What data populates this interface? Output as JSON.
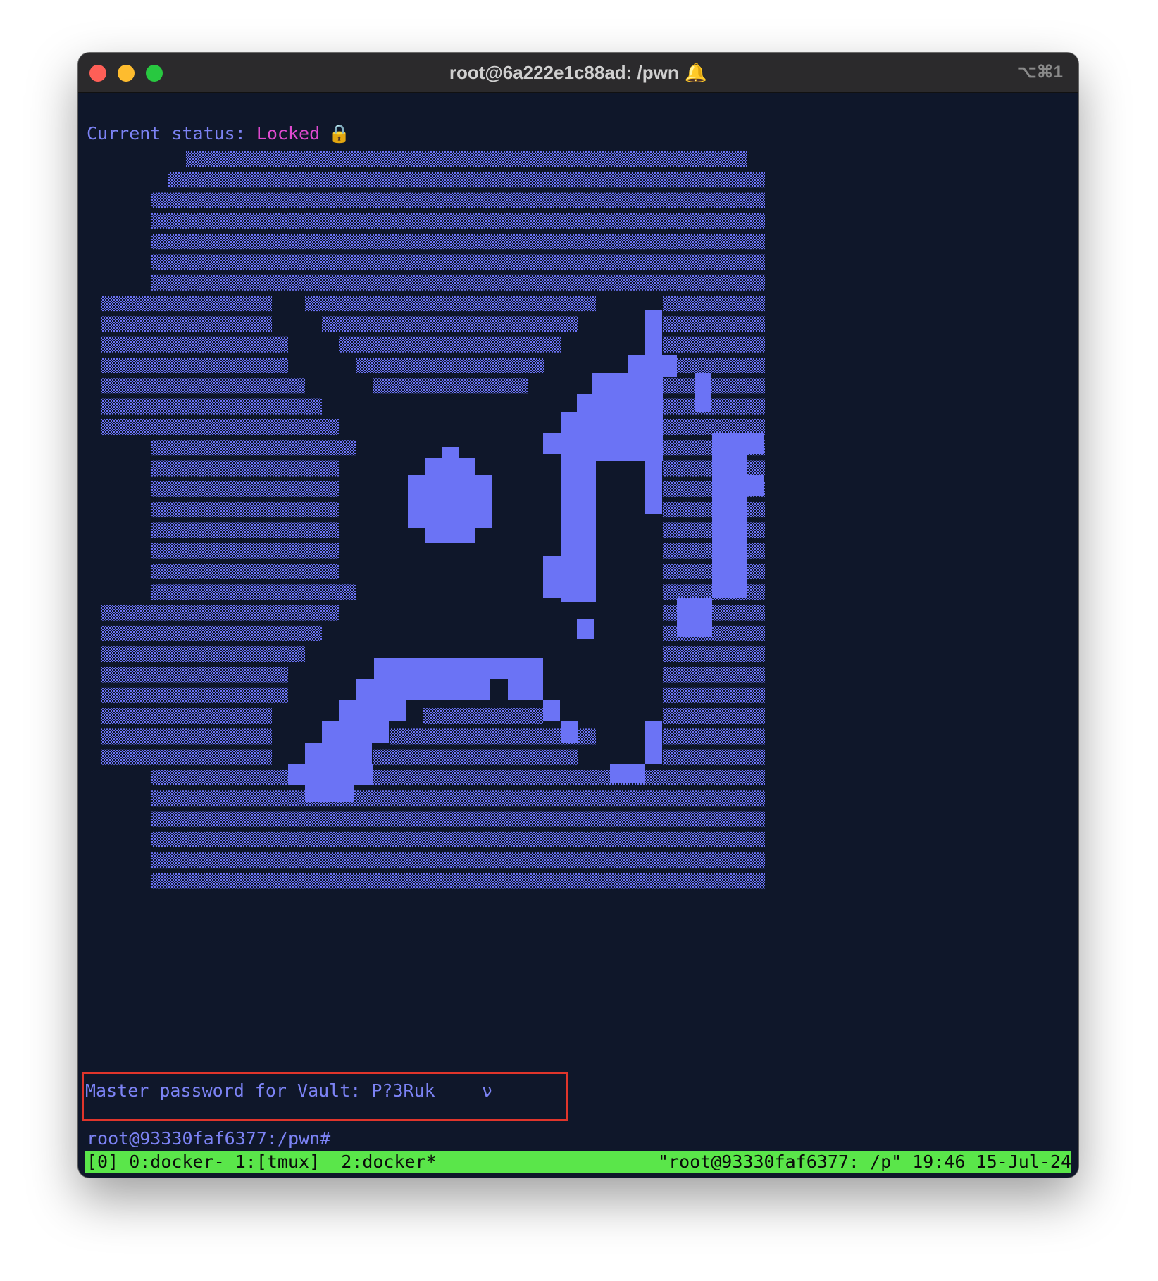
{
  "window": {
    "title": "root@6a222e1c88ad: /pwn",
    "bell_icon": "bell-icon",
    "shortcut": "⌥⌘1"
  },
  "terminal": {
    "status_label": "Current status: ",
    "status_value": "Locked",
    "lock_icon": "lock-icon",
    "password_prompt": "Master password for Vault: P?3Ruk",
    "cursor_glyph": "ν",
    "shell_prompt": "root@93330faf6377:/pwn#"
  },
  "tmux": {
    "left": "[0] 0:docker- 1:[tmux]  2:docker*",
    "right": "\"root@93330faf6377: /p\" 19:46 15-Jul-24"
  },
  "colors": {
    "background": "#0f172a",
    "text": "#7c83f5",
    "status_value": "#e04ad0",
    "art": "#6b73f5",
    "tmux_bar": "#5ae64a",
    "highlight_box": "#e0352b"
  }
}
